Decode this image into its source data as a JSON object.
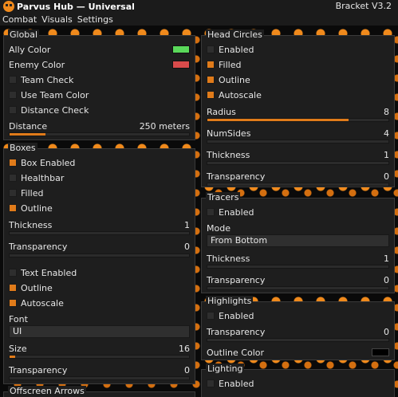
{
  "window": {
    "title": "Parvus Hub — Universal",
    "version": "Bracket V3.2"
  },
  "menu": [
    "Combat",
    "Visuals",
    "Settings"
  ],
  "colors": {
    "accent": "#e07b1a",
    "ally": "#5ad85a",
    "enemy": "#d84b4b",
    "outline": "#000000"
  },
  "global": {
    "title": "Global",
    "ally_color": "Ally Color",
    "enemy_color": "Enemy Color",
    "team_check": "Team Check",
    "use_team_color": "Use Team Color",
    "distance_check": "Distance Check",
    "distance": {
      "label": "Distance",
      "value": "250 meters",
      "fraction": 0.2
    }
  },
  "boxes": {
    "title": "Boxes",
    "box_enabled": "Box Enabled",
    "healthbar": "Healthbar",
    "filled": "Filled",
    "outline": "Outline",
    "thickness": {
      "label": "Thickness",
      "value": "1",
      "fraction": 0.0
    },
    "transparency": {
      "label": "Transparency",
      "value": "0",
      "fraction": 0.0
    },
    "text_enabled": "Text Enabled",
    "text_outline": "Outline",
    "autoscale": "Autoscale",
    "font": {
      "label": "Font",
      "value": "UI"
    },
    "size": {
      "label": "Size",
      "value": "16",
      "fraction": 0.02
    },
    "text_transparency": {
      "label": "Transparency",
      "value": "0",
      "fraction": 0.0
    }
  },
  "offscreen": {
    "title": "Offscreen Arrows"
  },
  "head_circles": {
    "title": "Head Circles",
    "enabled": "Enabled",
    "filled": "Filled",
    "outline": "Outline",
    "autoscale": "Autoscale",
    "radius": {
      "label": "Radius",
      "value": "8",
      "fraction": 0.78
    },
    "numsides": {
      "label": "NumSides",
      "value": "4",
      "fraction": 0.0
    },
    "thickness": {
      "label": "Thickness",
      "value": "1",
      "fraction": 0.0
    },
    "transparency": {
      "label": "Transparency",
      "value": "0",
      "fraction": 0.0
    }
  },
  "tracers": {
    "title": "Tracers",
    "enabled": "Enabled",
    "mode": {
      "label": "Mode",
      "value": "From Bottom"
    },
    "thickness": {
      "label": "Thickness",
      "value": "1",
      "fraction": 0.0
    },
    "transparency": {
      "label": "Transparency",
      "value": "0",
      "fraction": 0.0
    }
  },
  "highlights": {
    "title": "Highlights",
    "enabled": "Enabled",
    "transparency": {
      "label": "Transparency",
      "value": "0",
      "fraction": 0.0
    },
    "outline_color": "Outline Color"
  },
  "lighting": {
    "title": "Lighting",
    "enabled": "Enabled"
  }
}
